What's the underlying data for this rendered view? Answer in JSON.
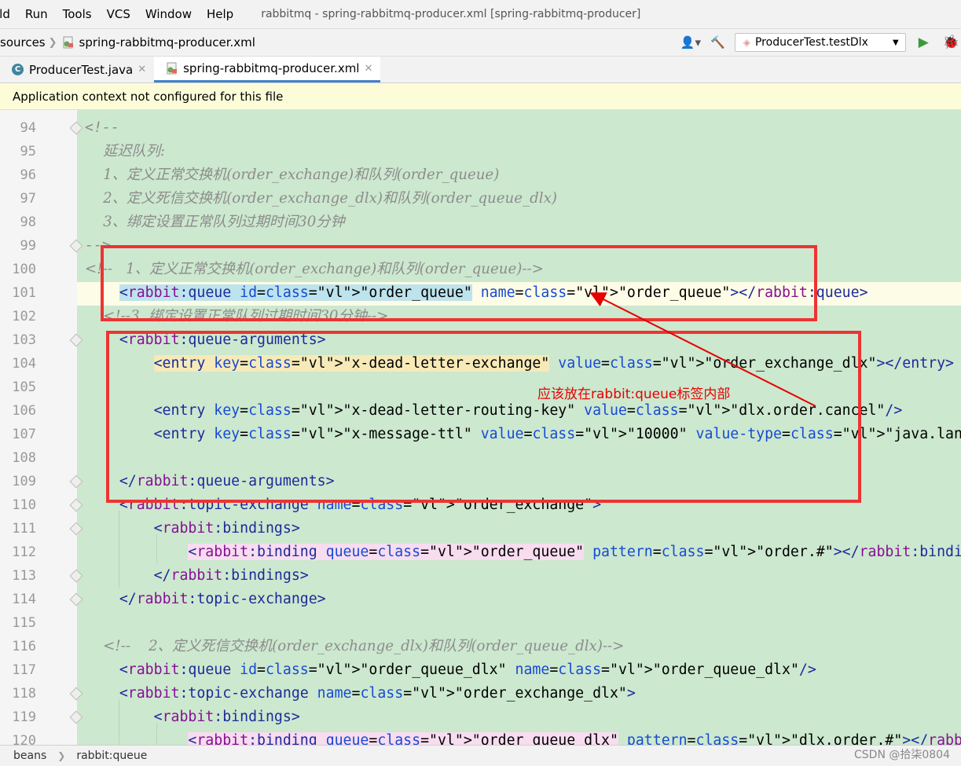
{
  "menubar": {
    "items": [
      "ild",
      "Run",
      "Tools",
      "VCS",
      "Window",
      "Help"
    ],
    "window_title": "rabbitmq - spring-rabbitmq-producer.xml [spring-rabbitmq-producer]"
  },
  "navbar": {
    "crumb_1": "sources",
    "crumb_2": "spring-rabbitmq-producer.xml",
    "run_config": "ProducerTest.testDlx"
  },
  "tabs": [
    {
      "label": "ProducerTest.java",
      "active": false
    },
    {
      "label": "spring-rabbitmq-producer.xml",
      "active": true
    }
  ],
  "infobar": {
    "message": "Application context not configured for this file"
  },
  "editor": {
    "current_line": 101,
    "lines": [
      {
        "n": "94",
        "text": "<!--"
      },
      {
        "n": "95",
        "text": "    延迟队列:"
      },
      {
        "n": "96",
        "text": "    1、定义正常交换机(order_exchange)和队列(order_queue)"
      },
      {
        "n": "97",
        "text": "    2、定义死信交换机(order_exchange_dlx)和队列(order_queue_dlx)"
      },
      {
        "n": "98",
        "text": "    3、绑定设置正常队列过期时间30分钟"
      },
      {
        "n": "99",
        "text": "-->"
      },
      {
        "n": "100",
        "text": "<!--   1、定义正常交换机(order_exchange)和队列(order_queue)-->"
      },
      {
        "n": "101",
        "text": "    <rabbit:queue id=\"order_queue\" name=\"order_queue\"></rabbit:queue>"
      },
      {
        "n": "102",
        "text": "    <!--3. 绑定设置正常队列过期时间30分钟-->"
      },
      {
        "n": "103",
        "text": "    <rabbit:queue-arguments>"
      },
      {
        "n": "104",
        "text": "        <entry key=\"x-dead-letter-exchange\" value=\"order_exchange_dlx\"></entry>"
      },
      {
        "n": "105",
        "text": ""
      },
      {
        "n": "106",
        "text": "        <entry key=\"x-dead-letter-routing-key\" value=\"dlx.order.cancel\"/>"
      },
      {
        "n": "107",
        "text": "        <entry key=\"x-message-ttl\" value=\"10000\" value-type=\"java.lang.Integer\"/>"
      },
      {
        "n": "108",
        "text": ""
      },
      {
        "n": "109",
        "text": "    </rabbit:queue-arguments>"
      },
      {
        "n": "110",
        "text": "    <rabbit:topic-exchange name=\"order_exchange\">"
      },
      {
        "n": "111",
        "text": "        <rabbit:bindings>"
      },
      {
        "n": "112",
        "text": "            <rabbit:binding queue=\"order_queue\" pattern=\"order.#\"></rabbit:binding>"
      },
      {
        "n": "113",
        "text": "        </rabbit:bindings>"
      },
      {
        "n": "114",
        "text": "    </rabbit:topic-exchange>"
      },
      {
        "n": "115",
        "text": ""
      },
      {
        "n": "116",
        "text": "    <!--    2、定义死信交换机(order_exchange_dlx)和队列(order_queue_dlx)-->"
      },
      {
        "n": "117",
        "text": "    <rabbit:queue id=\"order_queue_dlx\" name=\"order_queue_dlx\"/>"
      },
      {
        "n": "118",
        "text": "    <rabbit:topic-exchange name=\"order_exchange_dlx\">"
      },
      {
        "n": "119",
        "text": "        <rabbit:bindings>"
      },
      {
        "n": "120",
        "text": "            <rabbit:binding queue=\"order_queue_dlx\" pattern=\"dlx.order.#\"></rabbit:binding>"
      }
    ]
  },
  "annotation": {
    "text": "应该放在rabbit:queue标签内部"
  },
  "statusbar": {
    "crumb_1": "beans",
    "crumb_2": "rabbit:queue"
  },
  "watermark": "CSDN @拾柒0804",
  "colors": {
    "annotation": "#e60000",
    "editor_bg": "#cce8cf",
    "tag": "#1c2a9a",
    "attr": "#174ad4",
    "value": "#067d17"
  }
}
